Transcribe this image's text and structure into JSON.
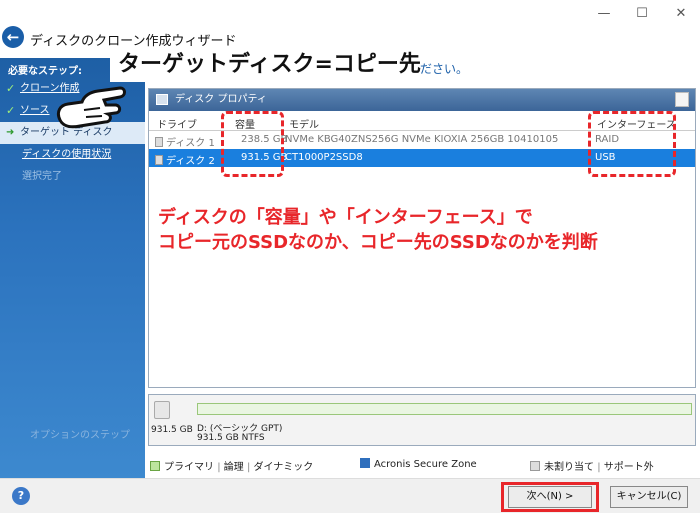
{
  "window": {
    "title": "ディスクのクローン作成ウィザード",
    "minimize": "—",
    "maximize": "☐",
    "close": "✕"
  },
  "sidebar": {
    "heading": "必要なステップ:",
    "items": [
      {
        "label": "クローン作成",
        "state": "done"
      },
      {
        "label": "ソース",
        "state": "done"
      },
      {
        "label": "ターゲット ディスク",
        "state": "active"
      },
      {
        "label": "ディスクの使用状況",
        "state": "link"
      },
      {
        "label": "選択完了",
        "state": "disabled"
      }
    ],
    "footer": "オプションのステップ"
  },
  "overlay_title": "ターゲットディスク=コピー先",
  "instruction_tail": "ださい。",
  "panel": {
    "title": "ディスク プロパティ",
    "columns": {
      "drive": "ドライブ",
      "capacity": "容量",
      "model": "モデル",
      "interface": "インターフェース"
    },
    "rows": [
      {
        "drive": "ディスク 1",
        "capacity": "238.5 GB",
        "model": "NVMe KBG40ZNS256G NVMe KIOXIA 256GB 10410105",
        "interface": "RAID",
        "selected": false
      },
      {
        "drive": "ディスク 2",
        "capacity": "931.5 GB",
        "model": "CT1000P2SSD8",
        "interface": "USB",
        "selected": true
      }
    ]
  },
  "note": {
    "line1": "ディスクの「容量」や「インターフェース」で",
    "line2": "コピー元のSSDなのか、コピー先のSSDなのかを判断"
  },
  "diskmap": {
    "size": "931.5 GB",
    "partition_name": "D: (ベーシック GPT)",
    "partition_info": "931.5 GB  NTFS"
  },
  "legend": {
    "primary": "プライマリ",
    "logical": "論理",
    "dynamic": "ダイナミック",
    "asz": "Acronis Secure Zone",
    "unallocated": "未割り当て",
    "unsupported": "サポート外"
  },
  "buttons": {
    "help": "?",
    "next": "次へ(N) >",
    "cancel": "キャンセル(C)"
  },
  "colors": {
    "accent": "#1a7fde",
    "annotation": "#e8262a",
    "sidebar": "#2b72bd"
  }
}
